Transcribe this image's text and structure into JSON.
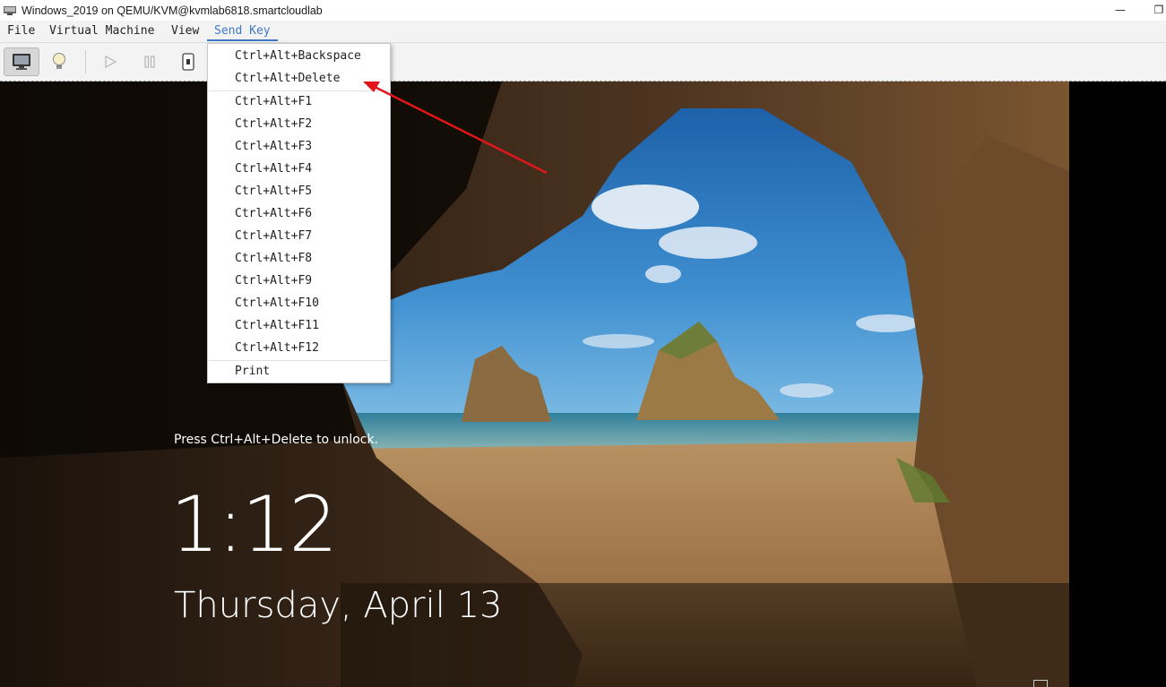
{
  "window": {
    "title": "Windows_2019 on QEMU/KVM@kvmlab6818.smartcloudlab",
    "minimize_glyph": "—",
    "restore_glyph": "❐"
  },
  "menubar": {
    "items": [
      "File",
      "Virtual Machine",
      "View",
      "Send Key"
    ],
    "active": "Send Key",
    "accent_color": "#3f78c4"
  },
  "toolbar": {
    "buttons": [
      "console-icon",
      "details-lightbulb-icon",
      "run-icon",
      "pause-icon",
      "shutdown-icon"
    ]
  },
  "send_key_menu": {
    "items": [
      "Ctrl+Alt+Backspace",
      "Ctrl+Alt+Delete",
      "Ctrl+Alt+F1",
      "Ctrl+Alt+F2",
      "Ctrl+Alt+F3",
      "Ctrl+Alt+F4",
      "Ctrl+Alt+F5",
      "Ctrl+Alt+F6",
      "Ctrl+Alt+F7",
      "Ctrl+Alt+F8",
      "Ctrl+Alt+F9",
      "Ctrl+Alt+F10",
      "Ctrl+Alt+F11",
      "Ctrl+Alt+F12",
      "Print"
    ],
    "highlighted_by_arrow": "Ctrl+Alt+Delete",
    "arrow_color": "#e0161a"
  },
  "lock_screen": {
    "unlock_hint": "Press Ctrl+Alt+Delete to unlock.",
    "time": "1:12",
    "date": "Thursday, April 13"
  }
}
